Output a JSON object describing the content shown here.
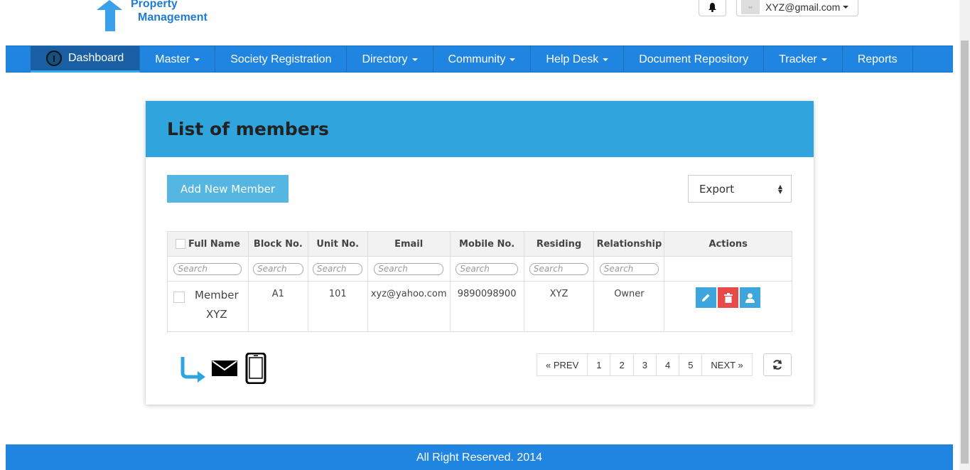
{
  "brand": {
    "line1": "Property",
    "line2": "Management"
  },
  "header": {
    "user_email": "XYZ@gmail.com"
  },
  "nav": {
    "items": [
      {
        "label": "Dashboard",
        "dropdown": false,
        "active": true
      },
      {
        "label": "Master",
        "dropdown": true
      },
      {
        "label": "Society Registration",
        "dropdown": false
      },
      {
        "label": "Directory",
        "dropdown": true
      },
      {
        "label": "Community",
        "dropdown": true
      },
      {
        "label": "Help Desk",
        "dropdown": true
      },
      {
        "label": "Document Repository",
        "dropdown": false
      },
      {
        "label": "Tracker",
        "dropdown": true
      },
      {
        "label": "Reports",
        "dropdown": false
      }
    ]
  },
  "panel": {
    "title": "List of members",
    "add_button": "Add New Member",
    "export_label": "Export"
  },
  "table": {
    "columns": [
      "Full Name",
      "Block No.",
      "Unit No.",
      "Email",
      "Mobile No.",
      "Residing",
      "Relationship",
      "Actions"
    ],
    "search_placeholder": "Search",
    "rows": [
      {
        "name_line1": "Member",
        "name_line2": "XYZ",
        "block": "A1",
        "unit": "101",
        "email": "xyz@yahoo.com",
        "mobile": "9890098900",
        "residing": "XYZ",
        "relationship": "Owner"
      }
    ]
  },
  "pagination": {
    "prev": "« PREV",
    "pages": [
      "1",
      "2",
      "3",
      "4",
      "5"
    ],
    "next": "NEXT »"
  },
  "footer": {
    "text": "All Right Reserved. 2014"
  },
  "colors": {
    "nav": "#1f85e0",
    "panel_header": "#2fa4dd",
    "edit": "#3ea6dc",
    "delete": "#e84a4a",
    "user": "#3ea6dc"
  }
}
